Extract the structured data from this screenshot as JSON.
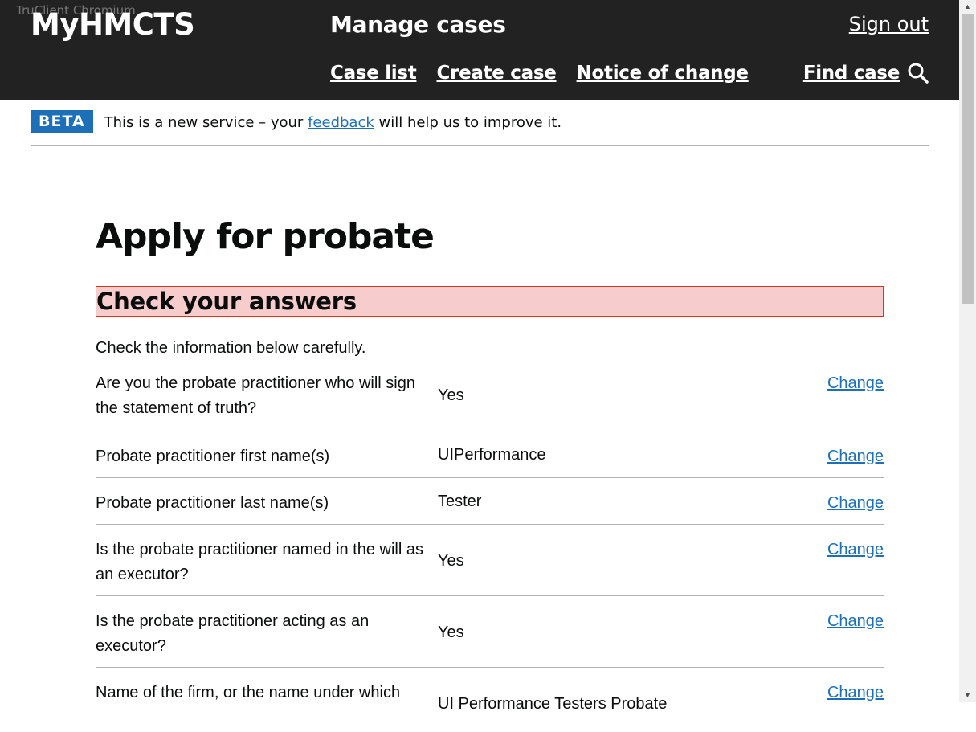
{
  "browser": {
    "watermark": "TruClient Chromium"
  },
  "header": {
    "brand": "MyHMCTS",
    "service_name": "Manage cases",
    "sign_out": "Sign out",
    "nav": [
      "Case list",
      "Create case",
      "Notice of change"
    ],
    "find_case": "Find case",
    "find_case_icon": "search-icon"
  },
  "phase_banner": {
    "tag": "BETA",
    "text_before": "This is a new service – your",
    "link": "feedback",
    "text_after": "will help us to improve it."
  },
  "main": {
    "title": "Apply for probate",
    "section_title": "Check your answers",
    "intro": "Check the information below carefully.",
    "change_label": "Change",
    "rows": [
      {
        "question": "Are you the probate practitioner who will sign the statement of truth?",
        "answer": "Yes"
      },
      {
        "question": "Probate practitioner first name(s)",
        "answer": "UIPerformance"
      },
      {
        "question": "Probate practitioner last name(s)",
        "answer": "Tester"
      },
      {
        "question": "Is the probate practitioner named in the will as an executor?",
        "answer": "Yes"
      },
      {
        "question": "Is the probate practitioner acting as an executor?",
        "answer": "Yes"
      },
      {
        "question": "Name of the firm, or the name under which",
        "answer": "UI Performance Testers Probate"
      }
    ]
  },
  "colors": {
    "header_bg": "#222222",
    "link": "#1d70b8",
    "beta_tag": "#1d70b8",
    "error_highlight": "#f6cccc",
    "error_border": "#d4351c"
  }
}
